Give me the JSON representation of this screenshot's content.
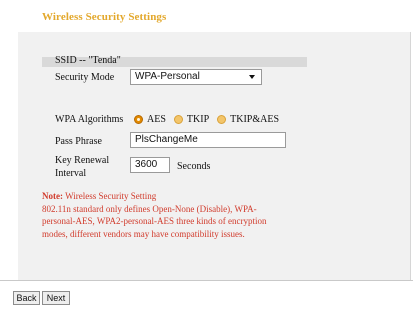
{
  "page": {
    "title": "Wireless Security Settings"
  },
  "ssid": {
    "label": "SSID -- \"Tenda\""
  },
  "security_mode": {
    "label": "Security Mode",
    "value": "WPA-Personal"
  },
  "wpa": {
    "label": "WPA Algorithms",
    "options": [
      {
        "label": "AES",
        "checked": true
      },
      {
        "label": "TKIP",
        "checked": false
      },
      {
        "label": "TKIP&AES",
        "checked": false
      }
    ]
  },
  "pass_phrase": {
    "label": "Pass Phrase",
    "value": "PlsChangeMe"
  },
  "key_renewal": {
    "label_line1": "Key Renewal",
    "label_line2": "Interval",
    "value": "3600",
    "unit": "Seconds"
  },
  "note": {
    "heading": "Note:",
    "line1_rest": " Wireless Security Setting",
    "line2": "802.11n standard only defines Open-None (Disable), WPA-",
    "line3": "personal-AES, WPA2-personal-AES three kinds of encryption",
    "line4": "modes, different vendors may have compatibility issues."
  },
  "footer": {
    "back_label": "Back",
    "next_label": "Next"
  },
  "colors": {
    "title": "#e3a82c",
    "note": "#d13b2c",
    "radio": "#f3c56a"
  }
}
